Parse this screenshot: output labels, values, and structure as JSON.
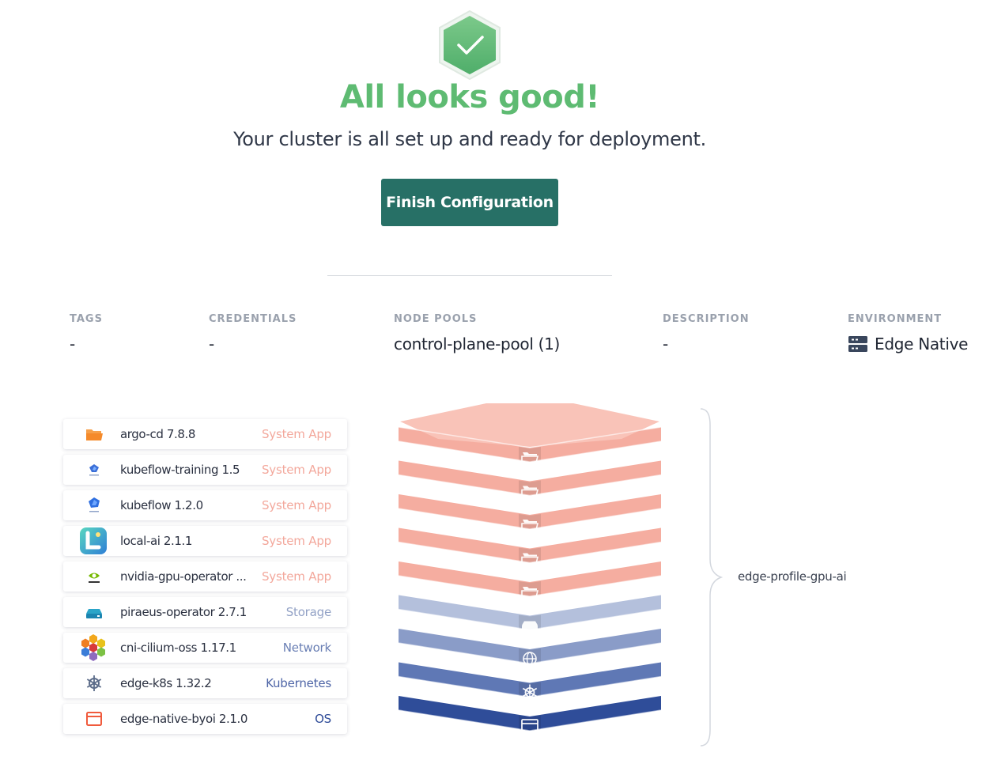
{
  "status": {
    "badge_icon": "check-hexagon-icon",
    "title": "All looks good!",
    "subtitle": "Your cluster is all set up and ready for deployment.",
    "finish_button": "Finish Configuration"
  },
  "meta": [
    {
      "label": "TAGS",
      "value": "-"
    },
    {
      "label": "CREDENTIALS",
      "value": "-"
    },
    {
      "label": "NODE POOLS",
      "value": "control-plane-pool (1)"
    },
    {
      "label": "DESCRIPTION",
      "value": "-"
    },
    {
      "label": "ENVIRONMENT",
      "value": "Edge Native",
      "icon": "edge-server-icon"
    }
  ],
  "layers": [
    {
      "name": "argo-cd 7.8.8",
      "type": "System App",
      "icon": "folder-icon"
    },
    {
      "name": "kubeflow-training 1.5",
      "type": "System App",
      "icon": "kubeflow-training-icon"
    },
    {
      "name": "kubeflow 1.2.0",
      "type": "System App",
      "icon": "kubeflow-icon"
    },
    {
      "name": "local-ai 2.1.1",
      "type": "System App",
      "icon": "local-ai-icon"
    },
    {
      "name": "nvidia-gpu-operator ...",
      "type": "System App",
      "icon": "nvidia-icon"
    },
    {
      "name": "piraeus-operator 2.7.1",
      "type": "Storage",
      "icon": "storage-icon"
    },
    {
      "name": "cni-cilium-oss 1.17.1",
      "type": "Network",
      "icon": "cilium-icon"
    },
    {
      "name": "edge-k8s 1.32.2",
      "type": "Kubernetes",
      "icon": "helm-wheel-icon"
    },
    {
      "name": "edge-native-byoi 2.1.0",
      "type": "OS",
      "icon": "os-window-icon"
    }
  ],
  "type_colors": {
    "System App": "#f3a89c",
    "Storage": "#93a2c6",
    "Network": "#6a7fb4",
    "Kubernetes": "#4d64a6",
    "OS": "#2e4b98"
  },
  "stack_colors": [
    "#f5ada0",
    "#f5ada0",
    "#f5ada0",
    "#f5ada0",
    "#f5ada0",
    "#b4c0dc",
    "#8a9cc8",
    "#5f78b5",
    "#2f4d99"
  ],
  "stack_icons": [
    "folder-icon",
    "folder-icon",
    "folder-icon",
    "folder-icon",
    "folder-icon",
    "storage-icon",
    "globe-icon",
    "helm-wheel-icon",
    "os-window-icon"
  ],
  "profile": {
    "name": "edge-profile-gpu-ai"
  },
  "colors": {
    "success": "#5ebb72",
    "button": "#277066"
  }
}
